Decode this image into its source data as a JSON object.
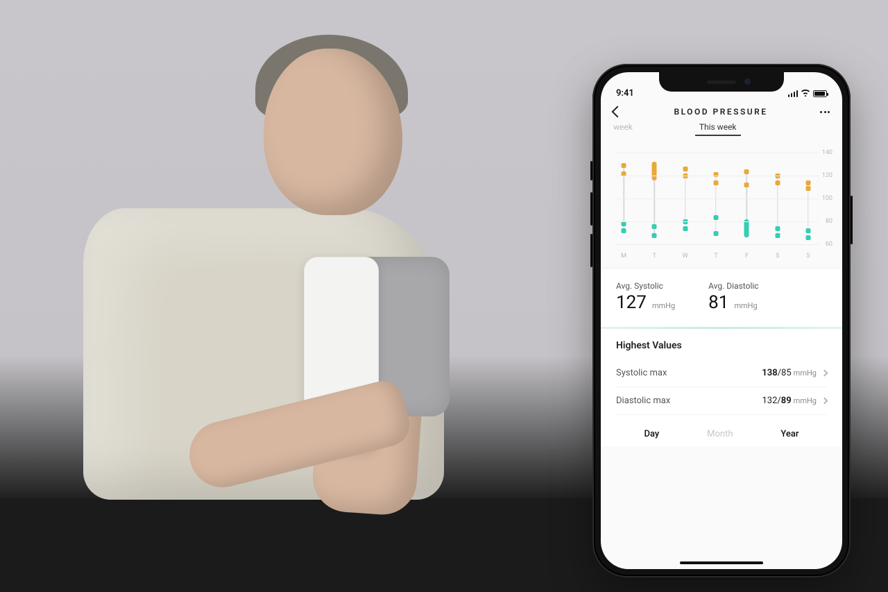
{
  "status_bar": {
    "time": "9:41"
  },
  "header": {
    "title": "BLOOD PRESSURE"
  },
  "tabs": {
    "previous": "week",
    "current": "This week"
  },
  "chart_data": {
    "type": "range",
    "ylim": [
      60,
      140
    ],
    "yticks": [
      60,
      80,
      100,
      120,
      140
    ],
    "categories": [
      "M",
      "T",
      "W",
      "T",
      "F",
      "S",
      "S"
    ],
    "series": [
      {
        "name": "Systolic",
        "color": "#e8a93a",
        "ranges": [
          {
            "lo": 128,
            "hi": 135
          },
          {
            "lo": 122,
            "hi": 138
          },
          {
            "lo": 126,
            "hi": 132
          },
          {
            "lo": 120,
            "hi": 127
          },
          {
            "lo": 118,
            "hi": 130
          },
          {
            "lo": 120,
            "hi": 126
          },
          {
            "lo": 115,
            "hi": 120
          }
        ]
      },
      {
        "name": "Diastolic",
        "color": "#33ceb3",
        "ranges": [
          {
            "lo": 78,
            "hi": 84
          },
          {
            "lo": 74,
            "hi": 82
          },
          {
            "lo": 80,
            "hi": 86
          },
          {
            "lo": 76,
            "hi": 90
          },
          {
            "lo": 72,
            "hi": 88
          },
          {
            "lo": 74,
            "hi": 80
          },
          {
            "lo": 72,
            "hi": 78
          }
        ]
      }
    ]
  },
  "averages": {
    "systolic": {
      "label": "Avg. Systolic",
      "value": "127",
      "unit": "mmHg"
    },
    "diastolic": {
      "label": "Avg. Diastolic",
      "value": "81",
      "unit": "mmHg"
    }
  },
  "highest": {
    "title": "Highest Values",
    "rows": [
      {
        "label": "Systolic max",
        "bold": "138",
        "rest": "/85",
        "unit": "mmHg"
      },
      {
        "label": "Diastolic max",
        "pre": "132/",
        "bold": "89",
        "unit": "mmHg"
      }
    ]
  },
  "range_switch": {
    "options": [
      "Day",
      "Month",
      "Year"
    ],
    "dim_index": 1
  }
}
